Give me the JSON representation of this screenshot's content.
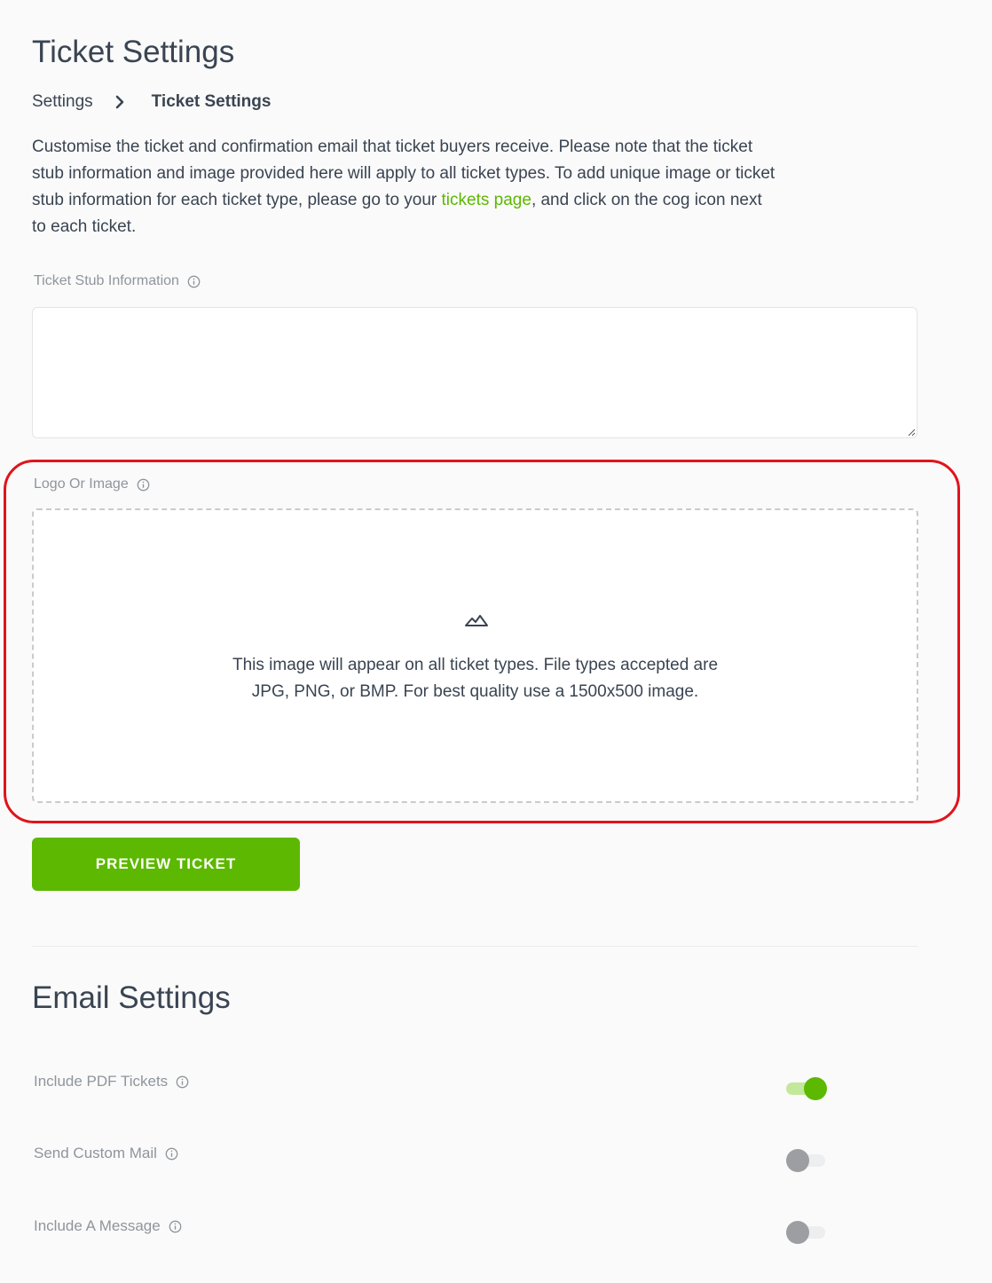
{
  "page": {
    "title": "Ticket Settings"
  },
  "breadcrumb": {
    "parent": "Settings",
    "current": "Ticket Settings"
  },
  "description": {
    "before_link": "Customise the ticket and confirmation email that ticket buyers receive. Please note that the ticket stub information and image provided here will apply to all ticket types. To add unique image or ticket stub information for each ticket type, please go to your ",
    "link_text": "tickets page",
    "after_link": ", and click on the cog icon next to each ticket."
  },
  "ticket_stub": {
    "label": "Ticket Stub Information",
    "value": "",
    "placeholder": ""
  },
  "logo": {
    "label": "Logo Or Image",
    "dropzone_icon": "image-icon",
    "dropzone_line1": "This image will appear on all ticket types. File types accepted are",
    "dropzone_line2": "JPG, PNG, or BMP. For best quality use a 1500x500 image."
  },
  "preview_button": {
    "label": "PREVIEW TICKET"
  },
  "email_settings": {
    "title": "Email Settings",
    "toggles": [
      {
        "label": "Include PDF Tickets",
        "on": true
      },
      {
        "label": "Send Custom Mail",
        "on": false
      },
      {
        "label": "Include A Message",
        "on": false
      }
    ]
  },
  "colors": {
    "accent": "#5cb800",
    "highlight": "#e0141a",
    "text": "#3a4452",
    "muted_label": "#8f959c"
  }
}
